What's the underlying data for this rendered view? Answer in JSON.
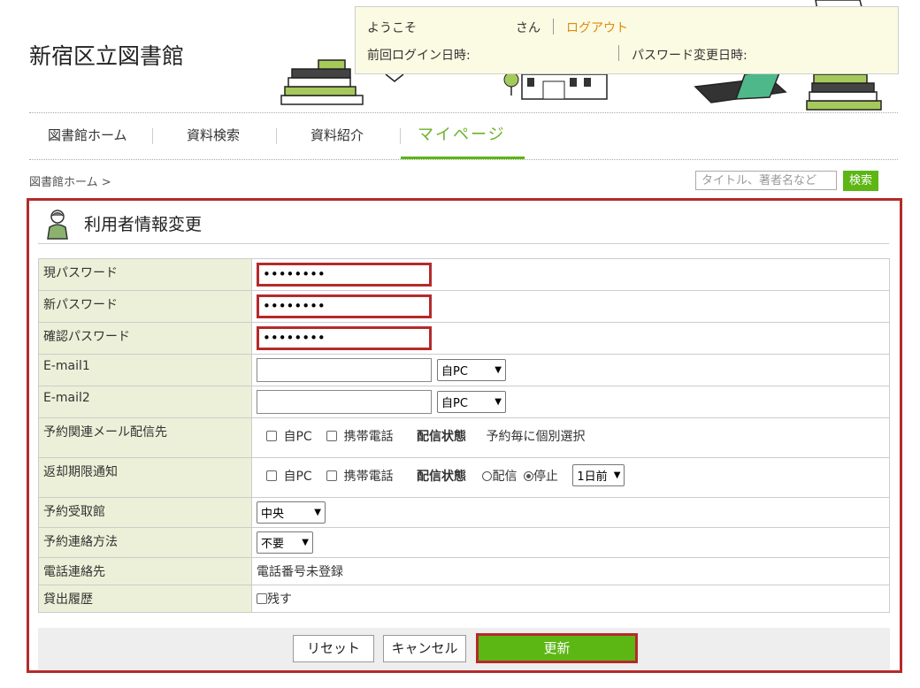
{
  "site": {
    "title": "新宿区立図書館"
  },
  "welcome": {
    "greeting": "ようこそ",
    "suffix": "さん",
    "logout": "ログアウト",
    "last_login_label": "前回ログイン日時:",
    "pw_changed_label": "パスワード変更日時:"
  },
  "nav": {
    "items": [
      {
        "label": "図書館ホーム"
      },
      {
        "label": "資料検索"
      },
      {
        "label": "資料紹介"
      },
      {
        "label": "マイページ"
      }
    ]
  },
  "breadcrumb": "図書館ホーム >",
  "search": {
    "placeholder": "タイトル、著者名など",
    "button": "検索"
  },
  "panel": {
    "title": "利用者情報変更",
    "rows": {
      "current_password": {
        "label": "現パスワード",
        "value": "••••••••"
      },
      "new_password": {
        "label": "新パスワード",
        "value": "••••••••"
      },
      "confirm_password": {
        "label": "確認パスワード",
        "value": "••••••••"
      },
      "email1": {
        "label": "E-mail1",
        "select": "自PC"
      },
      "email2": {
        "label": "E-mail2",
        "select": "自PC"
      },
      "reserve_mail": {
        "label": "予約関連メール配信先",
        "opt_pc": "自PC",
        "opt_mobile": "携帯電話",
        "status_label": "配信状態",
        "status_value": "予約毎に個別選択"
      },
      "return_notice": {
        "label": "返却期限通知",
        "opt_pc": "自PC",
        "opt_mobile": "携帯電話",
        "status_label": "配信状態",
        "radio_on": "配信",
        "radio_off": "停止",
        "days_select": "1日前"
      },
      "pickup_library": {
        "label": "予約受取館",
        "select": "中央"
      },
      "contact_method": {
        "label": "予約連絡方法",
        "select": "不要"
      },
      "phone": {
        "label": "電話連絡先",
        "value": "電話番号未登録"
      },
      "history": {
        "label": "貸出履歴",
        "opt": "残す"
      }
    },
    "buttons": {
      "reset": "リセット",
      "cancel": "キャンセル",
      "update": "更新"
    }
  },
  "colors": {
    "accent_green": "#5cb614",
    "highlight_red": "#b52a2a",
    "label_bg": "#ecf0d8",
    "welcome_bg": "#fbfbe3",
    "logout_orange": "#e08a10"
  }
}
